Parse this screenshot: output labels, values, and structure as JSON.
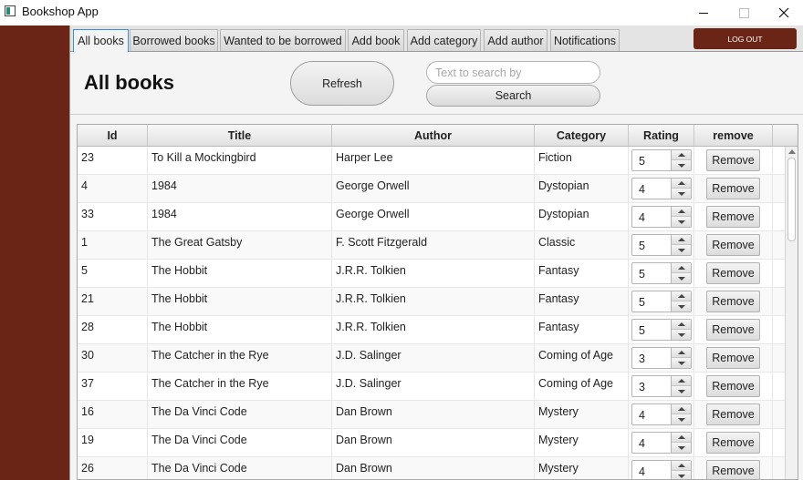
{
  "window": {
    "title": "Bookshop App"
  },
  "tabs": [
    {
      "label": "All books",
      "active": true
    },
    {
      "label": "Borrowed books",
      "active": false
    },
    {
      "label": "Wanted to be borrowed",
      "active": false
    },
    {
      "label": "Add book",
      "active": false
    },
    {
      "label": "Add category",
      "active": false
    },
    {
      "label": "Add author",
      "active": false
    },
    {
      "label": "Notifications",
      "active": false
    }
  ],
  "logout_label": "LOG OUT",
  "page": {
    "heading": "All books",
    "refresh_label": "Refresh",
    "search_placeholder": "Text to search by",
    "search_value": "",
    "search_label": "Search"
  },
  "table": {
    "columns": [
      "Id",
      "Title",
      "Author",
      "Category",
      "Rating",
      "remove"
    ],
    "remove_label": "Remove",
    "rows": [
      {
        "id": "23",
        "title": "To Kill a Mockingbird",
        "author": "Harper Lee",
        "category": "Fiction",
        "rating": "5"
      },
      {
        "id": "4",
        "title": "1984",
        "author": "George Orwell",
        "category": "Dystopian",
        "rating": "4"
      },
      {
        "id": "33",
        "title": "1984",
        "author": "George Orwell",
        "category": "Dystopian",
        "rating": "4"
      },
      {
        "id": "1",
        "title": "The Great Gatsby",
        "author": "F. Scott Fitzgerald",
        "category": "Classic",
        "rating": "5"
      },
      {
        "id": "5",
        "title": "The Hobbit",
        "author": "J.R.R. Tolkien",
        "category": "Fantasy",
        "rating": "5"
      },
      {
        "id": "21",
        "title": "The Hobbit",
        "author": "J.R.R. Tolkien",
        "category": "Fantasy",
        "rating": "5"
      },
      {
        "id": "28",
        "title": "The Hobbit",
        "author": "J.R.R. Tolkien",
        "category": "Fantasy",
        "rating": "5"
      },
      {
        "id": "30",
        "title": "The Catcher in the Rye",
        "author": "J.D. Salinger",
        "category": "Coming of Age",
        "rating": "3"
      },
      {
        "id": "37",
        "title": "The Catcher in the Rye",
        "author": "J.D. Salinger",
        "category": "Coming of Age",
        "rating": "3"
      },
      {
        "id": "16",
        "title": "The Da Vinci Code",
        "author": "Dan Brown",
        "category": "Mystery",
        "rating": "4"
      },
      {
        "id": "19",
        "title": "The Da Vinci Code",
        "author": "Dan Brown",
        "category": "Mystery",
        "rating": "4"
      },
      {
        "id": "26",
        "title": "The Da Vinci Code",
        "author": "Dan Brown",
        "category": "Mystery",
        "rating": "4"
      }
    ]
  },
  "colors": {
    "sidebar": "#6b2517",
    "logout": "#6b2517",
    "active_tab_border": "#3d8ed8"
  },
  "icons": {
    "window": "app-window-icon",
    "minimize": "minimize-icon",
    "maximize": "maximize-icon",
    "close": "close-icon",
    "spin_up": "chevron-up-icon",
    "spin_down": "chevron-down-icon"
  }
}
